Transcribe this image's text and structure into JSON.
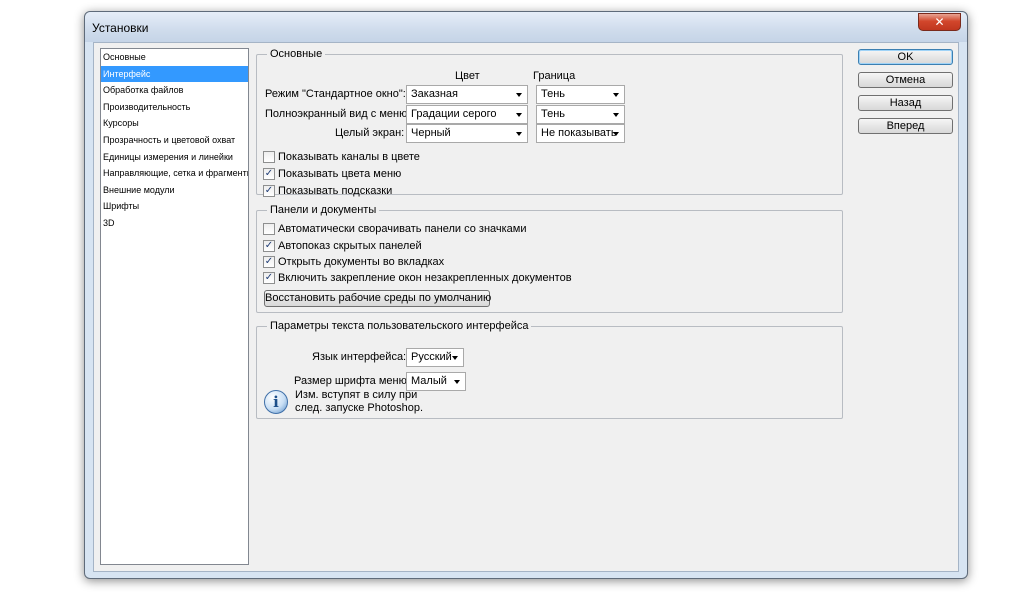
{
  "window": {
    "title": "Установки",
    "close_glyph": "✕"
  },
  "nav": {
    "items": [
      {
        "label": "Основные"
      },
      {
        "label": "Интерфейс"
      },
      {
        "label": "Обработка файлов"
      },
      {
        "label": "Производительность"
      },
      {
        "label": "Курсоры"
      },
      {
        "label": "Прозрачность и цветовой охват"
      },
      {
        "label": "Единицы измерения и линейки"
      },
      {
        "label": "Направляющие, сетка и фрагменты"
      },
      {
        "label": "Внешние модули"
      },
      {
        "label": "Шрифты"
      },
      {
        "label": "3D"
      }
    ],
    "selected": "Интерфейс"
  },
  "general": {
    "legend": "Основные",
    "col_color": "Цвет",
    "col_border": "Граница",
    "rows": [
      {
        "label": "Режим \"Стандартное окно\":",
        "color": "Заказная",
        "border": "Тень"
      },
      {
        "label": "Полноэкранный вид с меню:",
        "color": "Градации серого",
        "border": "Тень"
      },
      {
        "label": "Целый экран:",
        "color": "Черный",
        "border": "Не показывать"
      }
    ],
    "checkboxes": [
      {
        "label": "Показывать каналы в цвете",
        "checked": false
      },
      {
        "label": "Показывать цвета меню",
        "checked": true
      },
      {
        "label": "Показывать подсказки",
        "checked": true
      }
    ]
  },
  "panels": {
    "legend": "Панели и документы",
    "checkboxes": [
      {
        "label": "Автоматически сворачивать панели со значками",
        "checked": false
      },
      {
        "label": "Автопоказ скрытых панелей",
        "checked": true
      },
      {
        "label": "Открыть документы во вкладках",
        "checked": true
      },
      {
        "label": "Включить закрепление окон незакрепленных документов",
        "checked": true
      }
    ],
    "restore_button": "Восстановить рабочие среды по умолчанию"
  },
  "ui_text": {
    "legend": "Параметры текста пользовательского интерфейса",
    "language_label": "Язык интерфейса:",
    "language_value": "Русский",
    "font_size_label": "Размер шрифта меню:",
    "font_size_value": "Малый",
    "info_icon": "i",
    "info_line1": "Изм. вступят в силу при",
    "info_line2": "след. запуске Photoshop."
  },
  "buttons": {
    "ok": "OK",
    "cancel": "Отмена",
    "back": "Назад",
    "forward": "Вперед"
  },
  "check_glyph": "✓",
  "colors": {
    "selection": "#3399ff",
    "dialog_bg": "#f0f0f0",
    "frame": "#d7e4f2"
  }
}
